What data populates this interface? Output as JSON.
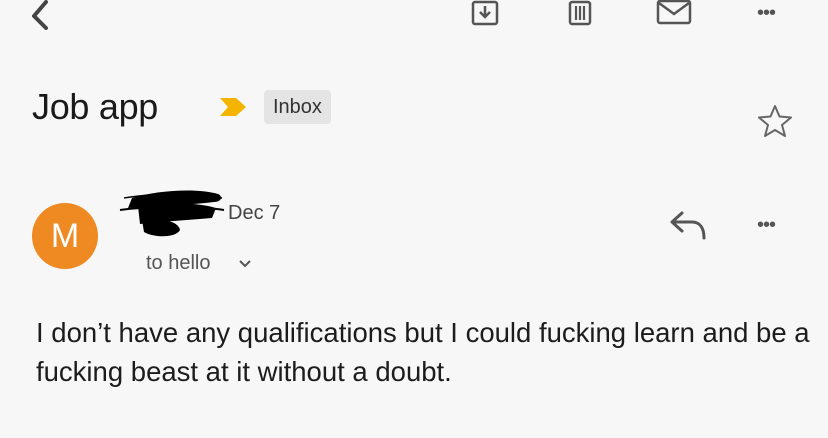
{
  "toolbar": {
    "back_icon": "back-arrow-icon",
    "archive_icon": "archive-icon",
    "delete_icon": "trash-icon",
    "mark_unread_icon": "mail-icon",
    "more_icon": "more-horizontal-icon",
    "more_label": "•••"
  },
  "email": {
    "subject": "Job app",
    "label": "Inbox",
    "label_arrow_color": "#f4b400",
    "starred": false,
    "sender_initial": "M",
    "avatar_color": "#ef8a22",
    "date": "Dec 7",
    "recipient_line": "to hello",
    "more_label": "•••",
    "body": "I don’t have any qualifications but I could fucking learn and be a fucking beast at it without a doubt."
  }
}
